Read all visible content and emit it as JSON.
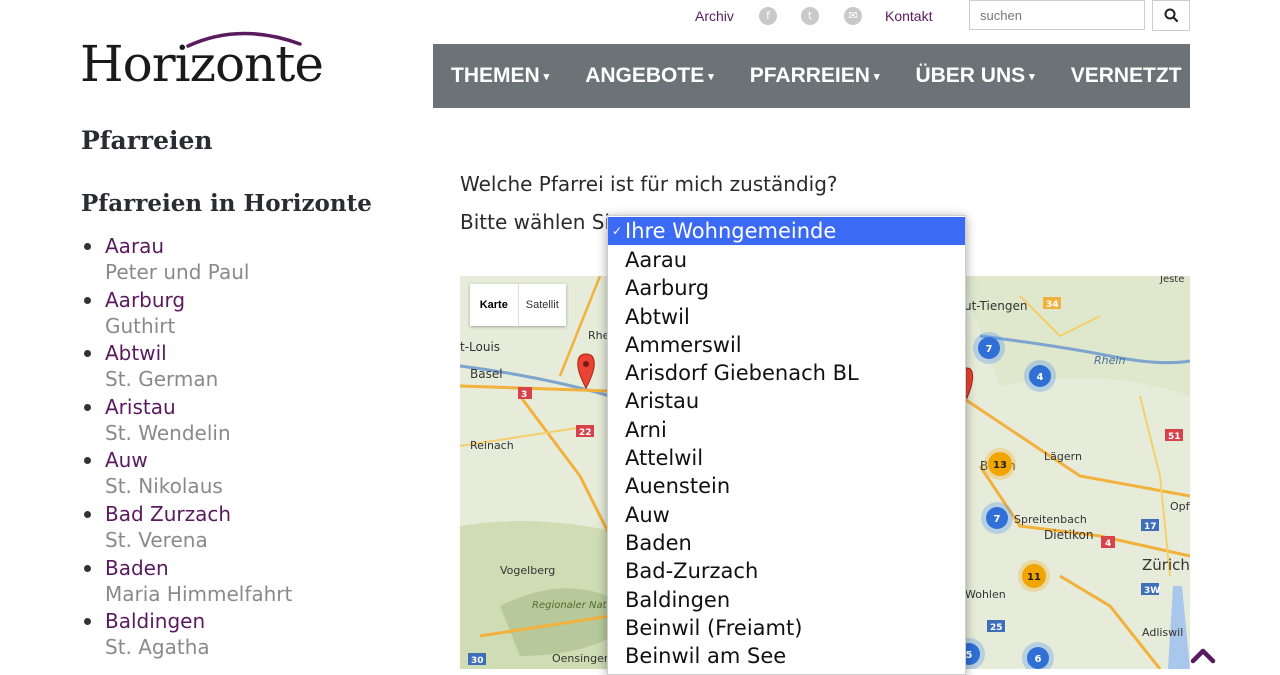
{
  "topbar": {
    "archiv": "Archiv",
    "kontakt": "Kontakt",
    "social": [
      {
        "name": "facebook-icon",
        "glyph": "f"
      },
      {
        "name": "twitter-icon",
        "glyph": "t"
      },
      {
        "name": "mail-icon",
        "glyph": "✉"
      }
    ],
    "search_placeholder": "suchen"
  },
  "logo": {
    "text": "Horizonte"
  },
  "nav": [
    {
      "label": "THEMEN",
      "caret": "▾"
    },
    {
      "label": "ANGEBOTE",
      "caret": "▾"
    },
    {
      "label": "PFARREIEN",
      "caret": "▾"
    },
    {
      "label": "ÜBER UNS",
      "caret": "▾"
    },
    {
      "label": "VERNETZT",
      "caret": ""
    }
  ],
  "page_title": "Pfarreien",
  "sidebar": {
    "heading": "Pfarreien in Horizonte",
    "items": [
      {
        "name": "Aarau",
        "sub": "Peter und Paul"
      },
      {
        "name": "Aarburg",
        "sub": "Guthirt"
      },
      {
        "name": "Abtwil",
        "sub": "St. German"
      },
      {
        "name": "Aristau",
        "sub": "St. Wendelin"
      },
      {
        "name": "Auw",
        "sub": "St. Nikolaus"
      },
      {
        "name": "Bad Zurzach",
        "sub": "St. Verena"
      },
      {
        "name": "Baden",
        "sub": "Maria Himmelfahrt"
      },
      {
        "name": "Baldingen",
        "sub": "St. Agatha"
      }
    ]
  },
  "main": {
    "question": "Welche Pfarrei ist für mich zuständig?",
    "choose_label": "Bitte wählen Sie:"
  },
  "map": {
    "type_karte": "Karte",
    "type_satellit": "Satellit",
    "labels": [
      "t-Louis",
      "Basel",
      "Reinach",
      "Vogelberg",
      "Regionaler Naturpark Thal",
      "Oensingen",
      "Rhe",
      "ut-Tiengen",
      "Rhein",
      "Lägern",
      "B",
      "n",
      "Spreitenbach",
      "Dietikon",
      "Opfik",
      "Zürich",
      "Wohlen",
      "Adliswil",
      "Jeste"
    ],
    "road_numbers": [
      "3",
      "22",
      "34",
      "51",
      "17",
      "3W",
      "4",
      "25",
      "30"
    ],
    "clusters": [
      "7",
      "4",
      "13",
      "7",
      "11",
      "5",
      "6"
    ]
  },
  "dropdown": {
    "selected": "Ihre Wohngemeinde",
    "options": [
      "Ihre Wohngemeinde",
      "Aarau",
      "Aarburg",
      "Abtwil",
      "Ammerswil",
      "Arisdorf Giebenach BL",
      "Aristau",
      "Arni",
      "Attelwil",
      "Auenstein",
      "Auw",
      "Baden",
      "Bad-Zurzach",
      "Baldingen",
      "Beinwil (Freiamt)",
      "Beinwil am See"
    ]
  },
  "colors": {
    "brand_purple": "#5a1a5e",
    "nav_bg": "#6b7377",
    "select_blue": "#3b6af5"
  }
}
